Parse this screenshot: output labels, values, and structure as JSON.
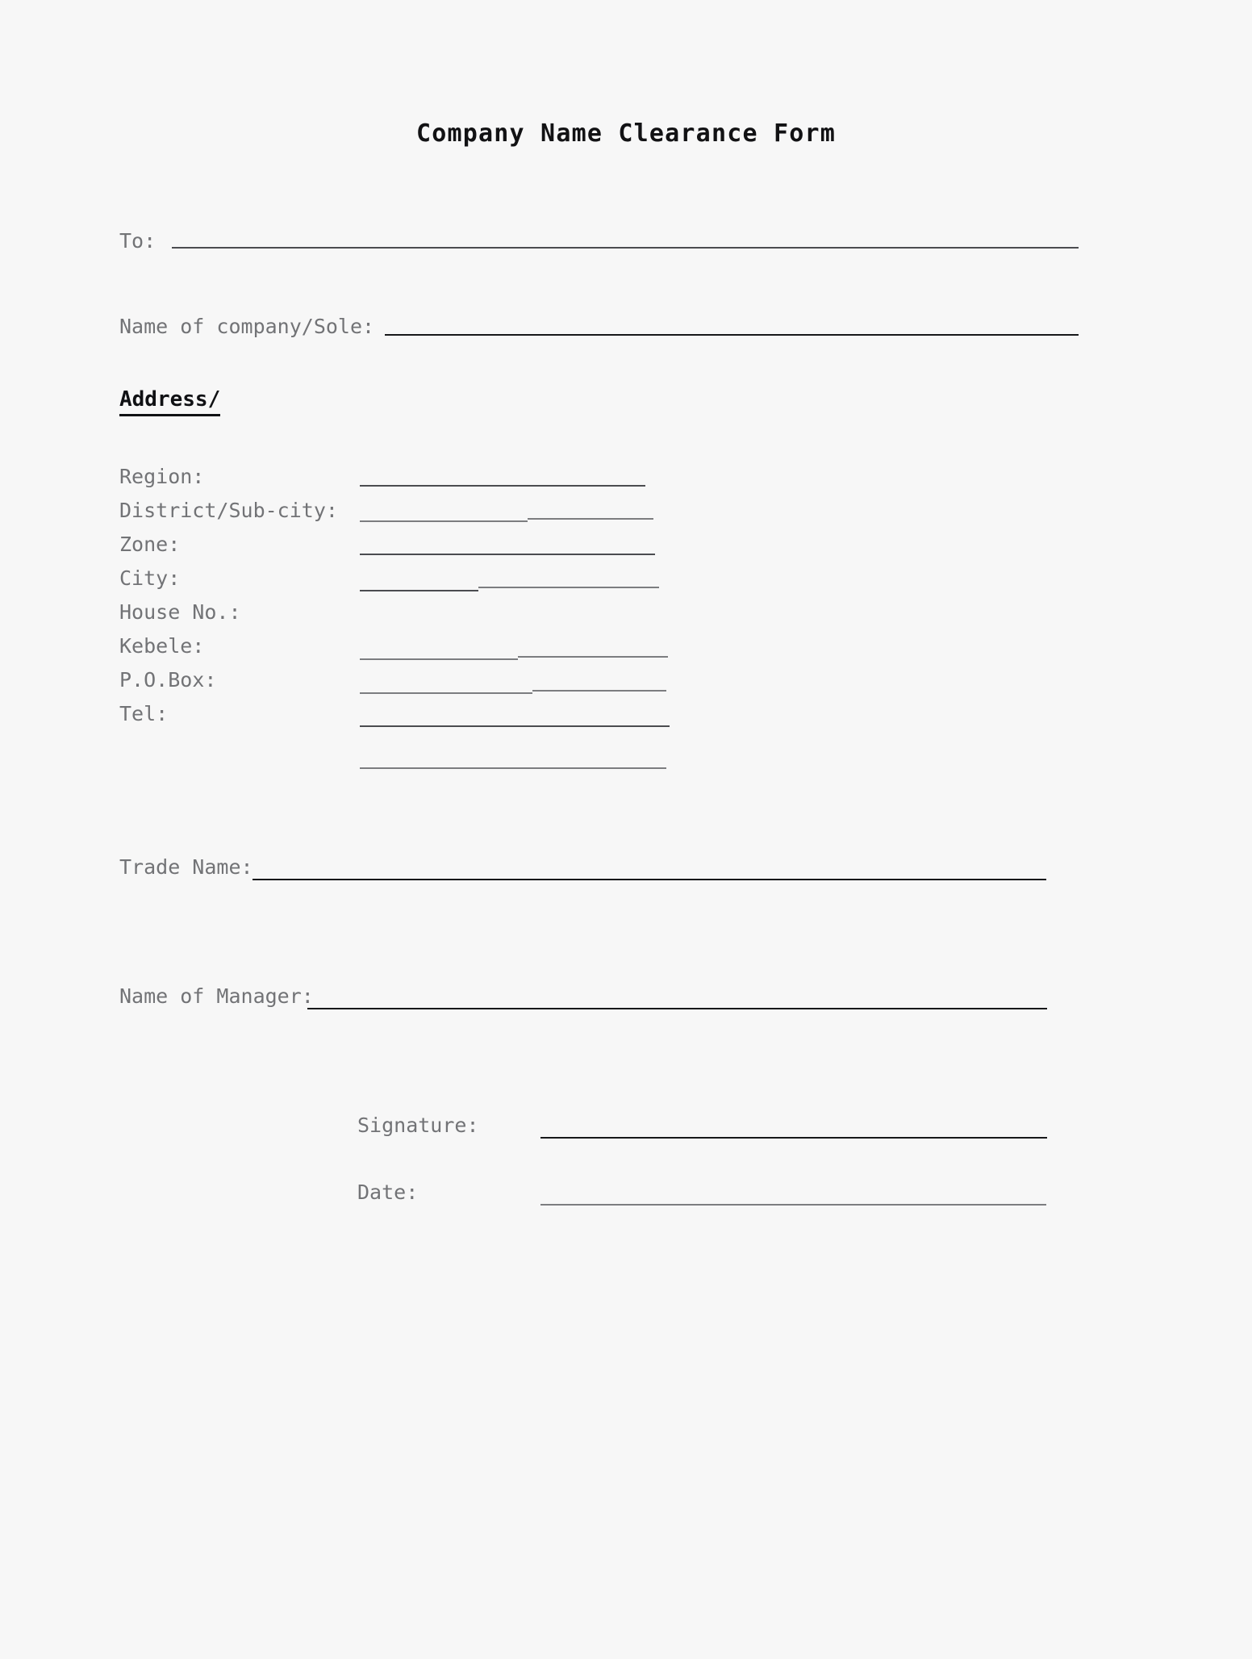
{
  "document": {
    "title": "Company Name Clearance Form",
    "background_color": "#f7f7f7",
    "text_color": "#727376",
    "rule_color": "#6a6b6e"
  },
  "top_fields": [
    {
      "label": "To:",
      "value": ""
    },
    {
      "label": "Name of company/Sole:",
      "value": ""
    }
  ],
  "address_section": {
    "heading": "Address/",
    "fields": [
      {
        "label": "Region:",
        "value": ""
      },
      {
        "label": "District/Sub-city:",
        "value": ""
      },
      {
        "label": "Zone:",
        "value": ""
      },
      {
        "label": "City:",
        "value": ""
      },
      {
        "label": "House No.:",
        "value": ""
      },
      {
        "label": "Kebele:",
        "value": ""
      },
      {
        "label": "P.O.Box:",
        "value": ""
      },
      {
        "label": "Tel:",
        "value": ""
      }
    ]
  },
  "trade_name_field": {
    "label": "Trade Name:",
    "value": ""
  },
  "manager_field": {
    "label": "Name of Manager:",
    "value": ""
  },
  "signoff_fields": [
    {
      "label": "Signature:",
      "value": ""
    },
    {
      "label": "Date:",
      "value": ""
    }
  ]
}
